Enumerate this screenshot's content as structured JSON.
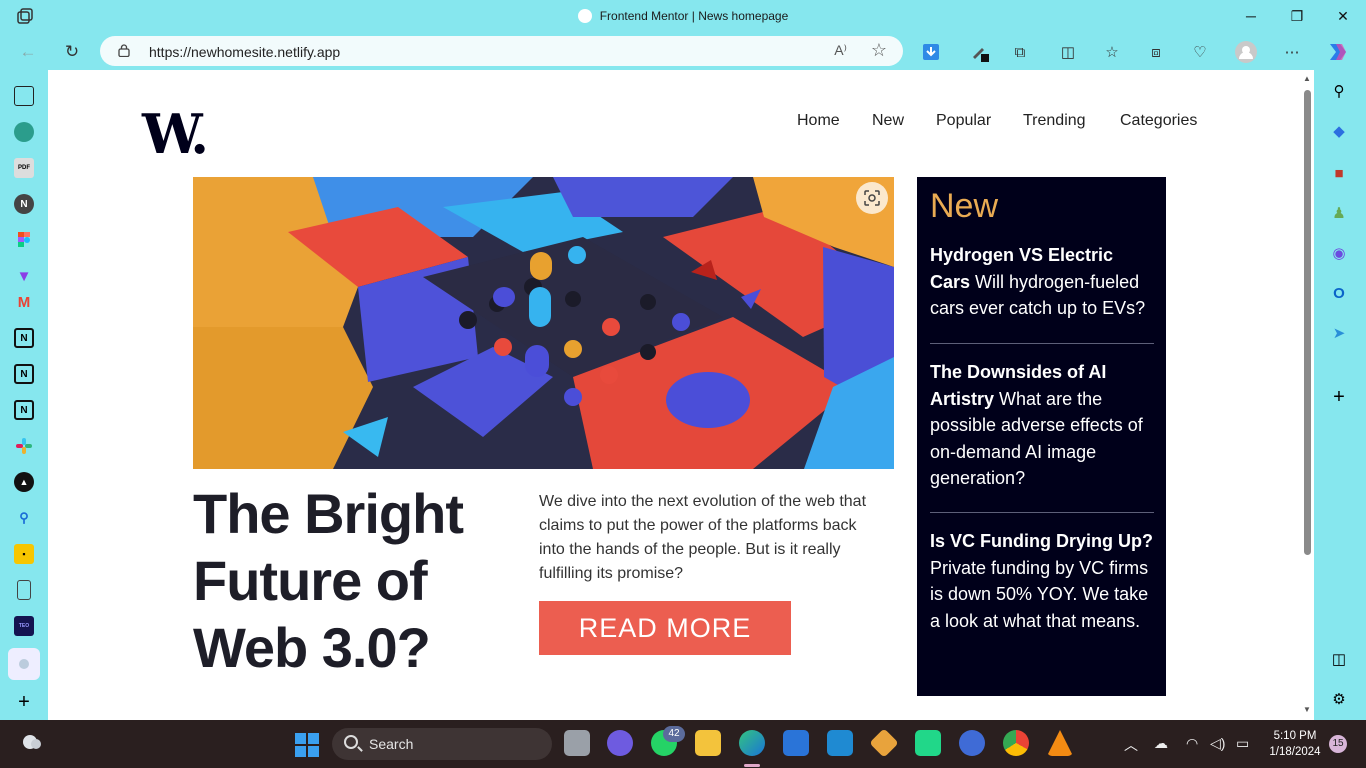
{
  "browser": {
    "tab_title": "Frontend Mentor | News homepage",
    "url": "https://newhomesite.netlify.app",
    "window_controls": {
      "minimize": "─",
      "restore": "❐",
      "close": "✕"
    }
  },
  "site": {
    "logo": "W.",
    "nav": [
      "Home",
      "New",
      "Popular",
      "Trending",
      "Categories"
    ],
    "hero": {
      "headline": "The Bright Future of Web 3.0?",
      "summary": "We dive into the next evolution of the web that claims to put the power of the platforms back into the hands of the people. But is it really fulfilling its promise?",
      "cta": "READ MORE"
    },
    "new_section": {
      "title": "New",
      "items": [
        {
          "title": "Hydrogen VS Electric Cars",
          "text": "Will hydrogen-fueled cars ever catch up to EVs?"
        },
        {
          "title": "The Downsides of AI Artistry",
          "text": "What are the possible adverse effects of on-demand AI image generation?"
        },
        {
          "title": "Is VC Funding Drying Up?",
          "text": "Private funding by VC firms is down 50% YOY. We take a look at what that means."
        }
      ]
    }
  },
  "colors": {
    "browser_chrome": "#86e7ee",
    "logo": "#00001a",
    "accent_orange": "#e9ab53",
    "cta_red": "#ec5e50",
    "panel_dark": "#00001a"
  },
  "taskbar": {
    "search_label": "Search",
    "whatsapp_badge": "42",
    "time": "5:10 PM",
    "date": "1/18/2024",
    "notifications": "15"
  }
}
